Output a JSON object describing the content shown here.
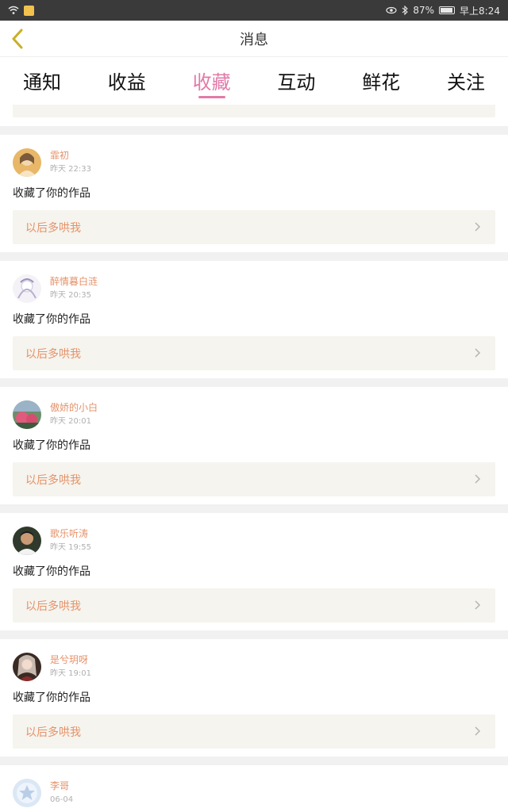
{
  "status": {
    "battery": "87%",
    "time": "早上8:24"
  },
  "header": {
    "title": "消息"
  },
  "tabs": [
    {
      "label": "通知"
    },
    {
      "label": "收益"
    },
    {
      "label": "收藏"
    },
    {
      "label": "互动"
    },
    {
      "label": "鲜花"
    },
    {
      "label": "关注"
    }
  ],
  "notifications": [
    {
      "name": "霏初",
      "time": "昨天 22:33",
      "message": "收藏了你的作品",
      "work": "以后多哄我"
    },
    {
      "name": "醉情暮白涟",
      "time": "昨天 20:35",
      "message": "收藏了你的作品",
      "work": "以后多哄我"
    },
    {
      "name": "傲娇的小白",
      "time": "昨天 20:01",
      "message": "收藏了你的作品",
      "work": "以后多哄我"
    },
    {
      "name": "歌乐听涛",
      "time": "昨天 19:55",
      "message": "收藏了你的作品",
      "work": "以后多哄我"
    },
    {
      "name": "是兮玥呀",
      "time": "昨天 19:01",
      "message": "收藏了你的作品",
      "work": "以后多哄我"
    },
    {
      "name": "李哥",
      "time": "06-04"
    }
  ]
}
